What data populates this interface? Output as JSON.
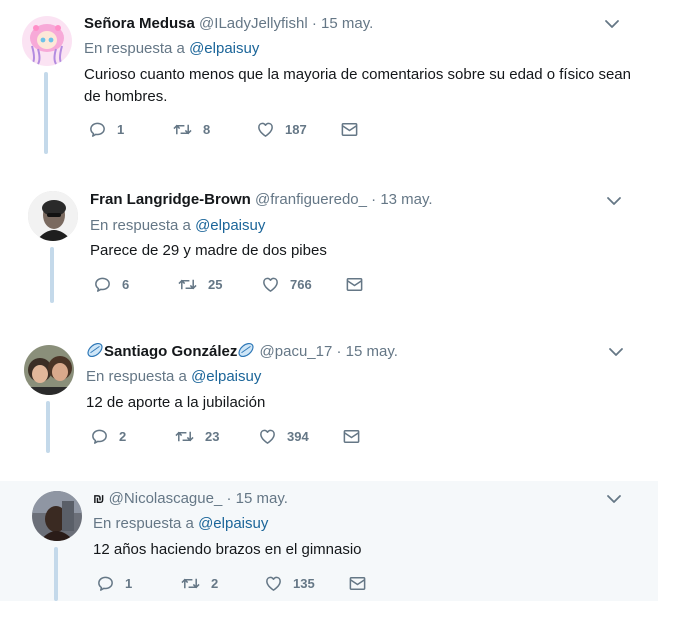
{
  "reply_prefix": "En respuesta a",
  "tweets": [
    {
      "name": "Señora Medusa",
      "handle": "@ILadyJellyfishl",
      "dot": "·",
      "date": "15 may.",
      "reply_to": "@elpaisuy",
      "text": "Curioso cuanto menos que la mayoria de comentarios sobre su edad o físico sean de hombres.",
      "replies": "1",
      "retweets": "8",
      "likes": "187"
    },
    {
      "name": "Fran Langridge-Brown",
      "handle": "@franfigueredo_",
      "dot": "·",
      "date": "13 may.",
      "reply_to": "@elpaisuy",
      "text": "Parece de 29 y madre de dos pibes",
      "replies": "6",
      "retweets": "25",
      "likes": "766"
    },
    {
      "name": "Santiago González",
      "handle": "@pacu_17",
      "dot": "·",
      "date": "15 may.",
      "reply_to": "@elpaisuy",
      "text": "12 de aporte a la jubilación",
      "replies": "2",
      "retweets": "23",
      "likes": "394"
    },
    {
      "name": "₪",
      "handle": "@Nicolascague_",
      "dot": "·",
      "date": "15 may.",
      "reply_to": "@elpaisuy",
      "text": "12 años haciendo brazos en el gimnasio",
      "replies": "1",
      "retweets": "2",
      "likes": "135"
    }
  ],
  "colors": {
    "link": "#1b6599",
    "muted": "#657786",
    "thread": "#c4d9ea",
    "highlight": "#f5f8fa"
  },
  "icons": [
    "reply-icon",
    "retweet-icon",
    "like-icon",
    "message-icon",
    "chevron-down-icon",
    "rugby-ball-emoji"
  ]
}
